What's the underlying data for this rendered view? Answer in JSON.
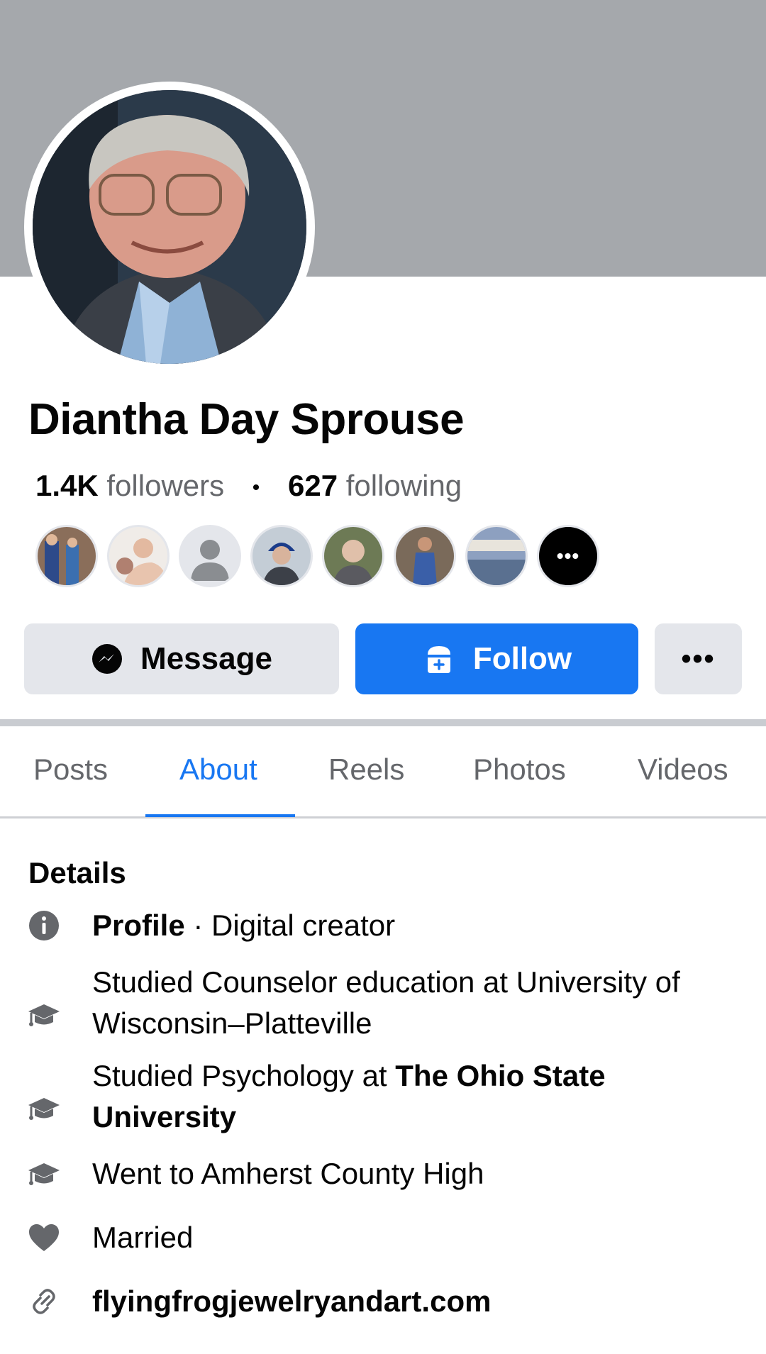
{
  "profile": {
    "name": "Diantha Day Sprouse",
    "followers_count": "1.4K",
    "followers_label": "followers",
    "separator": "•",
    "following_count": "627",
    "following_label": "following"
  },
  "friends_more_label": "•••",
  "actions": {
    "message_label": "Message",
    "follow_label": "Follow",
    "more_label": "•••"
  },
  "tabs": [
    {
      "label": "Posts"
    },
    {
      "label": "About"
    },
    {
      "label": "Reels"
    },
    {
      "label": "Photos"
    },
    {
      "label": "Videos"
    }
  ],
  "active_tab": "About",
  "details": {
    "title": "Details",
    "profile_label": "Profile",
    "profile_sep": " · ",
    "profile_category": "Digital creator",
    "edu1": "Studied Counselor education at University of Wisconsin–Platteville",
    "edu2_prefix": "Studied Psychology at ",
    "edu2_school": "The Ohio State University",
    "edu3": "Went to Amherst County High",
    "relationship": "Married",
    "website": "flyingfrogjewelryandart.com"
  },
  "colors": {
    "accent": "#1877f2",
    "cover": "#a5a8ac",
    "button_gray": "#e4e6eb",
    "secondary_text": "#65676b"
  },
  "icons": [
    "messenger-icon",
    "follow-icon",
    "info-icon",
    "graduation-cap-icon",
    "heart-icon",
    "link-icon"
  ]
}
